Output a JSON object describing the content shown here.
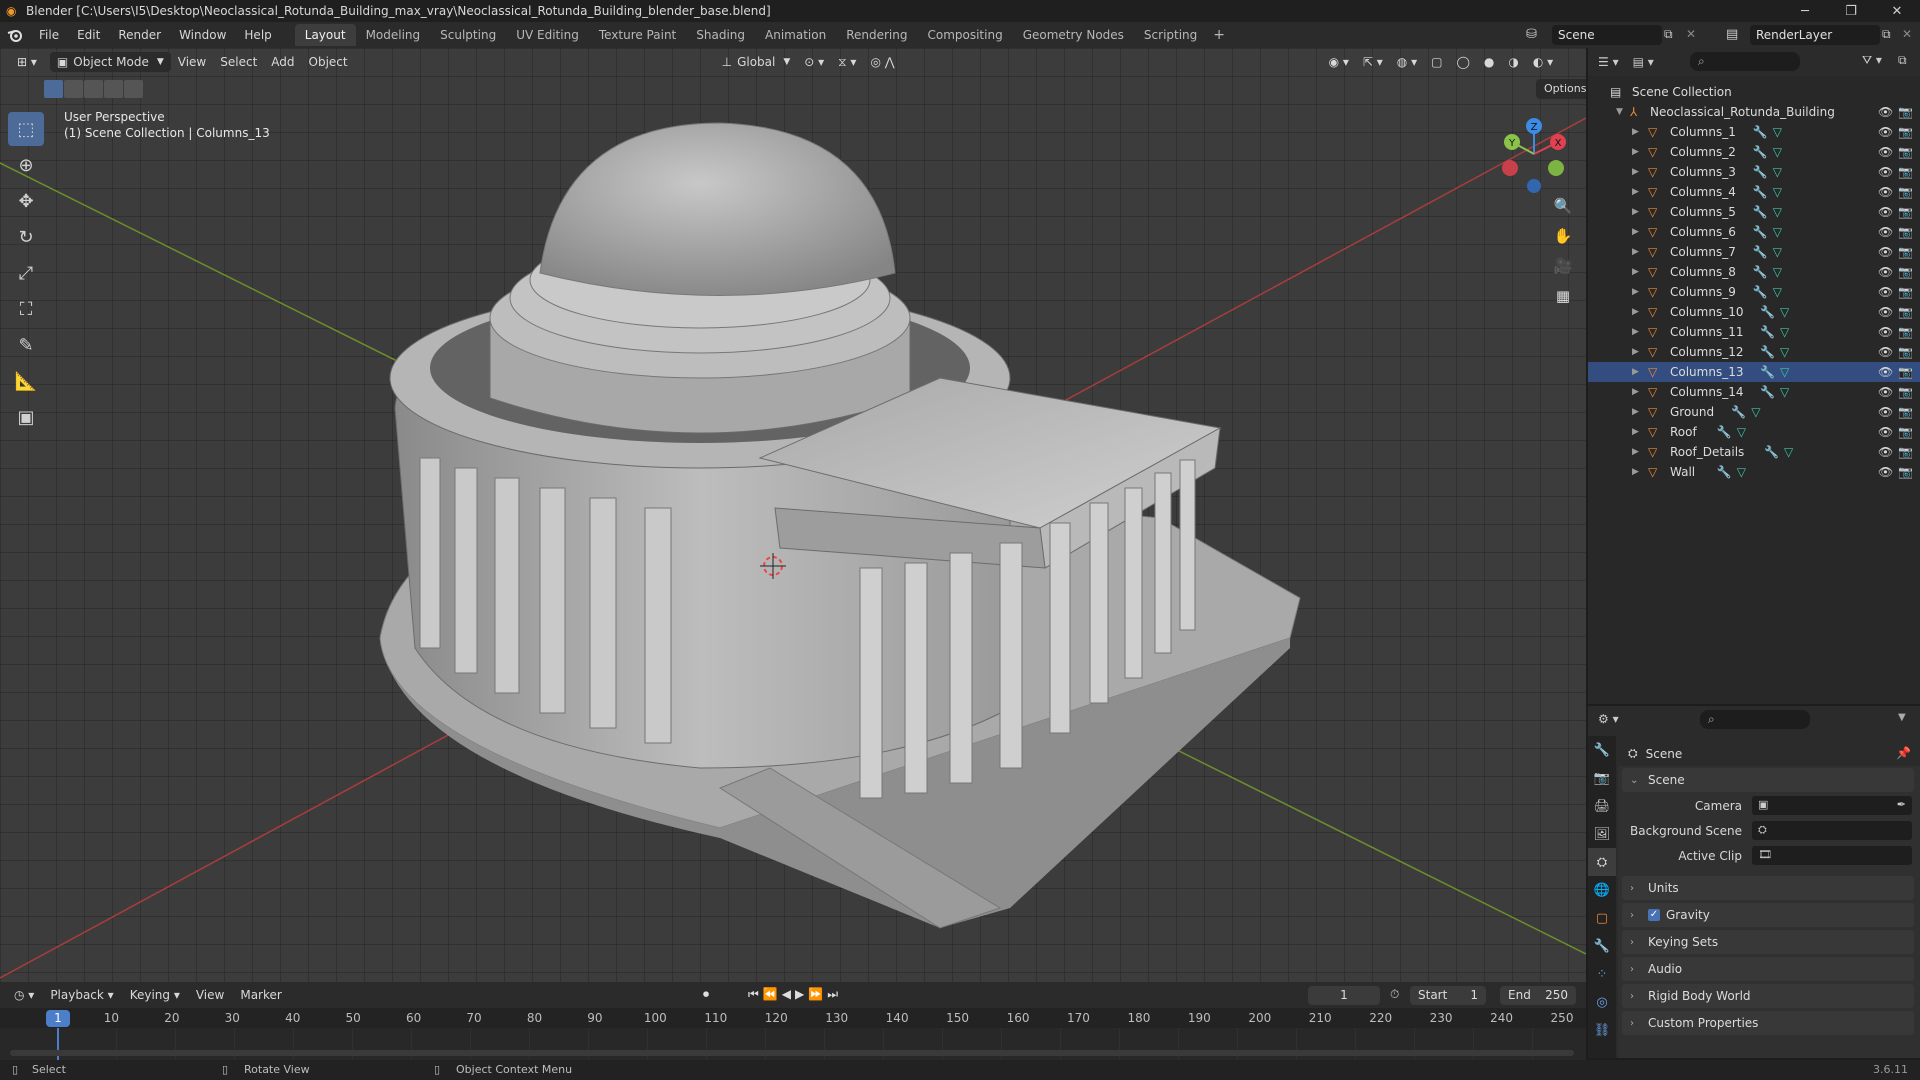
{
  "window": {
    "title": "Blender [C:\\Users\\I5\\Desktop\\Neoclassical_Rotunda_Building_max_vray\\Neoclassical_Rotunda_Building_blender_base.blend]"
  },
  "menu": {
    "items": [
      "File",
      "Edit",
      "Render",
      "Window",
      "Help"
    ]
  },
  "workspaces": {
    "tabs": [
      "Layout",
      "Modeling",
      "Sculpting",
      "UV Editing",
      "Texture Paint",
      "Shading",
      "Animation",
      "Rendering",
      "Compositing",
      "Geometry Nodes",
      "Scripting"
    ],
    "active": "Layout",
    "add": "+"
  },
  "scene": {
    "name": "Scene",
    "view_layer": "RenderLayer"
  },
  "viewport": {
    "mode": "Object Mode",
    "menus": [
      "View",
      "Select",
      "Add",
      "Object"
    ],
    "transform_orientation": "Global",
    "options_label": "Options",
    "overlay_line1": "User Perspective",
    "overlay_line2": "(1) Scene Collection | Columns_13",
    "gizmo": {
      "x": "X",
      "y": "Y",
      "z": "Z"
    }
  },
  "outliner": {
    "root": "Scene Collection",
    "collection": "Neoclassical_Rotunda_Building",
    "objects": [
      "Columns_1",
      "Columns_2",
      "Columns_3",
      "Columns_4",
      "Columns_5",
      "Columns_6",
      "Columns_7",
      "Columns_8",
      "Columns_9",
      "Columns_10",
      "Columns_11",
      "Columns_12",
      "Columns_13",
      "Columns_14",
      "Ground",
      "Roof",
      "Roof_Details",
      "Wall"
    ],
    "selected": "Columns_13"
  },
  "properties": {
    "header": "Scene",
    "sections": {
      "scene": "Scene",
      "camera_label": "Camera",
      "background_label": "Background Scene",
      "clip_label": "Active Clip",
      "units": "Units",
      "gravity": "Gravity",
      "keying_sets": "Keying Sets",
      "audio": "Audio",
      "rigid_body": "Rigid Body World",
      "custom": "Custom Properties"
    },
    "gravity_enabled": true
  },
  "timeline": {
    "menus": [
      "Playback",
      "Keying",
      "View",
      "Marker"
    ],
    "current_frame": "1",
    "start_label": "Start",
    "start": "1",
    "end_label": "End",
    "end": "250",
    "ticks": [
      "10",
      "20",
      "30",
      "40",
      "50",
      "60",
      "70",
      "80",
      "90",
      "100",
      "110",
      "120",
      "130",
      "140",
      "150",
      "160",
      "170",
      "180",
      "190",
      "200",
      "210",
      "220",
      "230",
      "240",
      "250"
    ],
    "cursor": "1"
  },
  "status": {
    "select": "Select",
    "rotate": "Rotate View",
    "context": "Object Context Menu",
    "version": "3.6.11"
  },
  "colors": {
    "accent": "#4772b3",
    "object_icon": "#e8893a",
    "mesh_icon": "#3fc5a2",
    "modifier_icon": "#7ea7e6",
    "axis_x": "#e0404f",
    "axis_y": "#8bc34a",
    "axis_z": "#3c8ce6"
  }
}
